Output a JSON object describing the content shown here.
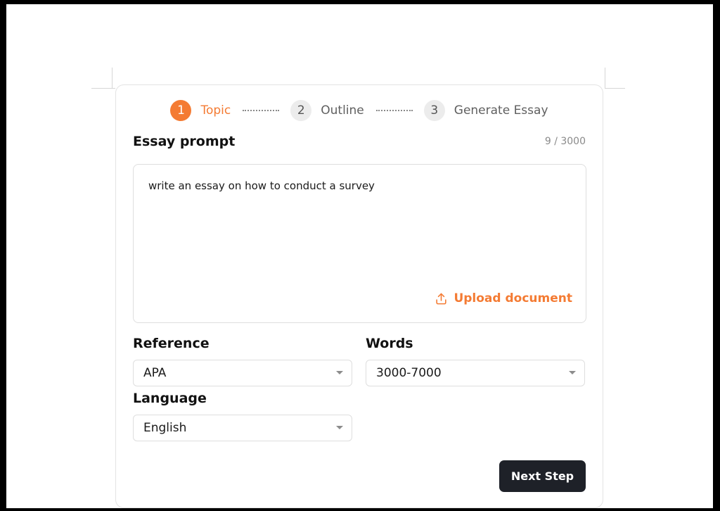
{
  "steps": [
    {
      "number": "1",
      "label": "Topic"
    },
    {
      "number": "2",
      "label": "Outline"
    },
    {
      "number": "3",
      "label": "Generate Essay"
    }
  ],
  "active_step": 1,
  "prompt": {
    "title": "Essay prompt",
    "counter": "9 / 3000",
    "value": "write an essay on how to conduct a survey",
    "upload_label": "Upload document",
    "upload_icon": "upload-icon"
  },
  "reference": {
    "label": "Reference",
    "value": "APA"
  },
  "words": {
    "label": "Words",
    "value": "3000-7000"
  },
  "language": {
    "label": "Language",
    "value": "English"
  },
  "next_button": "Next Step",
  "colors": {
    "accent": "#f47b33",
    "button_bg": "#1e2128",
    "border": "#dedede"
  }
}
